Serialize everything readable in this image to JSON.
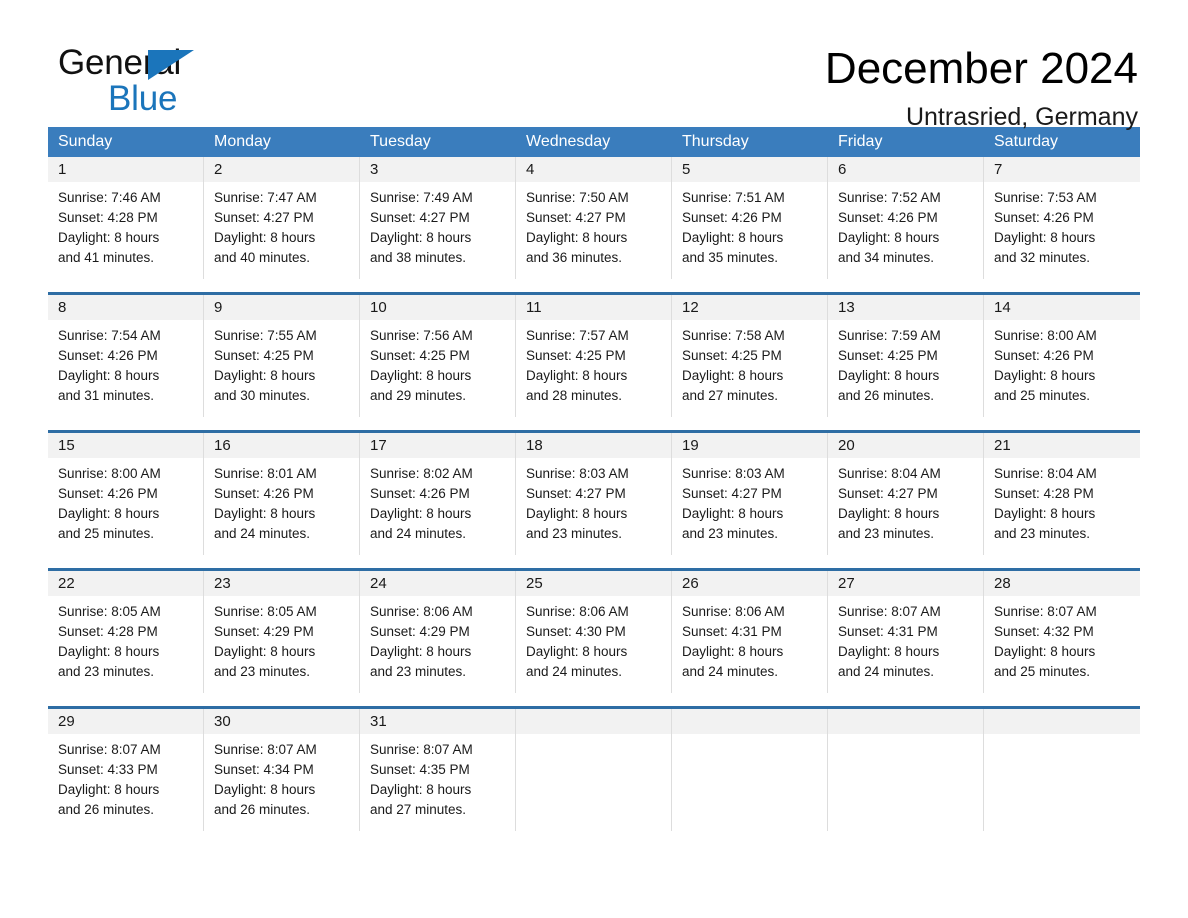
{
  "brand": {
    "name_part1": "General",
    "name_part2": "Blue",
    "triangle_color": "#1b75bb"
  },
  "header": {
    "title": "December 2024",
    "location": "Untrasried, Germany"
  },
  "colors": {
    "header_blue": "#3a7dbd",
    "row_rule_blue": "#2e6da4",
    "daynum_band": "#f2f2f2",
    "brand_blue": "#1b75bb"
  },
  "weekdays": [
    "Sunday",
    "Monday",
    "Tuesday",
    "Wednesday",
    "Thursday",
    "Friday",
    "Saturday"
  ],
  "weeks": [
    [
      {
        "day": "1",
        "sunrise": "Sunrise: 7:46 AM",
        "sunset": "Sunset: 4:28 PM",
        "daylight1": "Daylight: 8 hours",
        "daylight2": "and 41 minutes."
      },
      {
        "day": "2",
        "sunrise": "Sunrise: 7:47 AM",
        "sunset": "Sunset: 4:27 PM",
        "daylight1": "Daylight: 8 hours",
        "daylight2": "and 40 minutes."
      },
      {
        "day": "3",
        "sunrise": "Sunrise: 7:49 AM",
        "sunset": "Sunset: 4:27 PM",
        "daylight1": "Daylight: 8 hours",
        "daylight2": "and 38 minutes."
      },
      {
        "day": "4",
        "sunrise": "Sunrise: 7:50 AM",
        "sunset": "Sunset: 4:27 PM",
        "daylight1": "Daylight: 8 hours",
        "daylight2": "and 36 minutes."
      },
      {
        "day": "5",
        "sunrise": "Sunrise: 7:51 AM",
        "sunset": "Sunset: 4:26 PM",
        "daylight1": "Daylight: 8 hours",
        "daylight2": "and 35 minutes."
      },
      {
        "day": "6",
        "sunrise": "Sunrise: 7:52 AM",
        "sunset": "Sunset: 4:26 PM",
        "daylight1": "Daylight: 8 hours",
        "daylight2": "and 34 minutes."
      },
      {
        "day": "7",
        "sunrise": "Sunrise: 7:53 AM",
        "sunset": "Sunset: 4:26 PM",
        "daylight1": "Daylight: 8 hours",
        "daylight2": "and 32 minutes."
      }
    ],
    [
      {
        "day": "8",
        "sunrise": "Sunrise: 7:54 AM",
        "sunset": "Sunset: 4:26 PM",
        "daylight1": "Daylight: 8 hours",
        "daylight2": "and 31 minutes."
      },
      {
        "day": "9",
        "sunrise": "Sunrise: 7:55 AM",
        "sunset": "Sunset: 4:25 PM",
        "daylight1": "Daylight: 8 hours",
        "daylight2": "and 30 minutes."
      },
      {
        "day": "10",
        "sunrise": "Sunrise: 7:56 AM",
        "sunset": "Sunset: 4:25 PM",
        "daylight1": "Daylight: 8 hours",
        "daylight2": "and 29 minutes."
      },
      {
        "day": "11",
        "sunrise": "Sunrise: 7:57 AM",
        "sunset": "Sunset: 4:25 PM",
        "daylight1": "Daylight: 8 hours",
        "daylight2": "and 28 minutes."
      },
      {
        "day": "12",
        "sunrise": "Sunrise: 7:58 AM",
        "sunset": "Sunset: 4:25 PM",
        "daylight1": "Daylight: 8 hours",
        "daylight2": "and 27 minutes."
      },
      {
        "day": "13",
        "sunrise": "Sunrise: 7:59 AM",
        "sunset": "Sunset: 4:25 PM",
        "daylight1": "Daylight: 8 hours",
        "daylight2": "and 26 minutes."
      },
      {
        "day": "14",
        "sunrise": "Sunrise: 8:00 AM",
        "sunset": "Sunset: 4:26 PM",
        "daylight1": "Daylight: 8 hours",
        "daylight2": "and 25 minutes."
      }
    ],
    [
      {
        "day": "15",
        "sunrise": "Sunrise: 8:00 AM",
        "sunset": "Sunset: 4:26 PM",
        "daylight1": "Daylight: 8 hours",
        "daylight2": "and 25 minutes."
      },
      {
        "day": "16",
        "sunrise": "Sunrise: 8:01 AM",
        "sunset": "Sunset: 4:26 PM",
        "daylight1": "Daylight: 8 hours",
        "daylight2": "and 24 minutes."
      },
      {
        "day": "17",
        "sunrise": "Sunrise: 8:02 AM",
        "sunset": "Sunset: 4:26 PM",
        "daylight1": "Daylight: 8 hours",
        "daylight2": "and 24 minutes."
      },
      {
        "day": "18",
        "sunrise": "Sunrise: 8:03 AM",
        "sunset": "Sunset: 4:27 PM",
        "daylight1": "Daylight: 8 hours",
        "daylight2": "and 23 minutes."
      },
      {
        "day": "19",
        "sunrise": "Sunrise: 8:03 AM",
        "sunset": "Sunset: 4:27 PM",
        "daylight1": "Daylight: 8 hours",
        "daylight2": "and 23 minutes."
      },
      {
        "day": "20",
        "sunrise": "Sunrise: 8:04 AM",
        "sunset": "Sunset: 4:27 PM",
        "daylight1": "Daylight: 8 hours",
        "daylight2": "and 23 minutes."
      },
      {
        "day": "21",
        "sunrise": "Sunrise: 8:04 AM",
        "sunset": "Sunset: 4:28 PM",
        "daylight1": "Daylight: 8 hours",
        "daylight2": "and 23 minutes."
      }
    ],
    [
      {
        "day": "22",
        "sunrise": "Sunrise: 8:05 AM",
        "sunset": "Sunset: 4:28 PM",
        "daylight1": "Daylight: 8 hours",
        "daylight2": "and 23 minutes."
      },
      {
        "day": "23",
        "sunrise": "Sunrise: 8:05 AM",
        "sunset": "Sunset: 4:29 PM",
        "daylight1": "Daylight: 8 hours",
        "daylight2": "and 23 minutes."
      },
      {
        "day": "24",
        "sunrise": "Sunrise: 8:06 AM",
        "sunset": "Sunset: 4:29 PM",
        "daylight1": "Daylight: 8 hours",
        "daylight2": "and 23 minutes."
      },
      {
        "day": "25",
        "sunrise": "Sunrise: 8:06 AM",
        "sunset": "Sunset: 4:30 PM",
        "daylight1": "Daylight: 8 hours",
        "daylight2": "and 24 minutes."
      },
      {
        "day": "26",
        "sunrise": "Sunrise: 8:06 AM",
        "sunset": "Sunset: 4:31 PM",
        "daylight1": "Daylight: 8 hours",
        "daylight2": "and 24 minutes."
      },
      {
        "day": "27",
        "sunrise": "Sunrise: 8:07 AM",
        "sunset": "Sunset: 4:31 PM",
        "daylight1": "Daylight: 8 hours",
        "daylight2": "and 24 minutes."
      },
      {
        "day": "28",
        "sunrise": "Sunrise: 8:07 AM",
        "sunset": "Sunset: 4:32 PM",
        "daylight1": "Daylight: 8 hours",
        "daylight2": "and 25 minutes."
      }
    ],
    [
      {
        "day": "29",
        "sunrise": "Sunrise: 8:07 AM",
        "sunset": "Sunset: 4:33 PM",
        "daylight1": "Daylight: 8 hours",
        "daylight2": "and 26 minutes."
      },
      {
        "day": "30",
        "sunrise": "Sunrise: 8:07 AM",
        "sunset": "Sunset: 4:34 PM",
        "daylight1": "Daylight: 8 hours",
        "daylight2": "and 26 minutes."
      },
      {
        "day": "31",
        "sunrise": "Sunrise: 8:07 AM",
        "sunset": "Sunset: 4:35 PM",
        "daylight1": "Daylight: 8 hours",
        "daylight2": "and 27 minutes."
      },
      {
        "day": "",
        "sunrise": "",
        "sunset": "",
        "daylight1": "",
        "daylight2": ""
      },
      {
        "day": "",
        "sunrise": "",
        "sunset": "",
        "daylight1": "",
        "daylight2": ""
      },
      {
        "day": "",
        "sunrise": "",
        "sunset": "",
        "daylight1": "",
        "daylight2": ""
      },
      {
        "day": "",
        "sunrise": "",
        "sunset": "",
        "daylight1": "",
        "daylight2": ""
      }
    ]
  ]
}
